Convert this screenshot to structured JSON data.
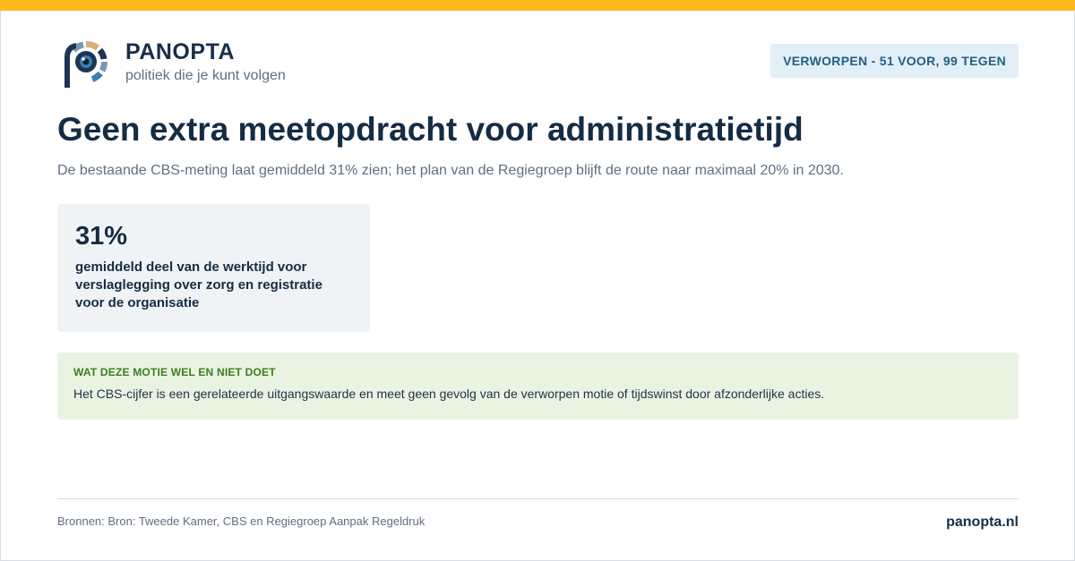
{
  "brand": {
    "name": "PANOPTA",
    "tagline": "politiek die je kunt volgen",
    "colors": {
      "navy": "#1b3552",
      "gold": "#d7b07a",
      "steel": "#7a98b4",
      "blue": "#3f7cb0",
      "accent_bar": "#fbb81e"
    }
  },
  "status": {
    "label": "VERWORPEN - 51 VOOR, 99 TEGEN"
  },
  "main": {
    "title": "Geen extra meetopdracht voor administratietijd",
    "subtitle": "De bestaande CBS-meting laat gemiddeld 31% zien; het plan van de Regiegroep blijft de route naar maximaal 20% in 2030."
  },
  "stat": {
    "value": "31%",
    "label": "gemiddeld deel van de werktijd voor verslaglegging over zorg en registratie voor de organisatie"
  },
  "note": {
    "heading": "WAT DEZE MOTIE WEL EN NIET DOET",
    "text": "Het CBS-cijfer is een gerelateerde uitgangswaarde en meet geen gevolg van de verworpen motie of tijdswinst door afzonderlijke acties."
  },
  "footer": {
    "sources": "Bronnen: Bron: Tweede Kamer, CBS en Regiegroep Aanpak Regeldruk",
    "site": "panopta.nl"
  }
}
